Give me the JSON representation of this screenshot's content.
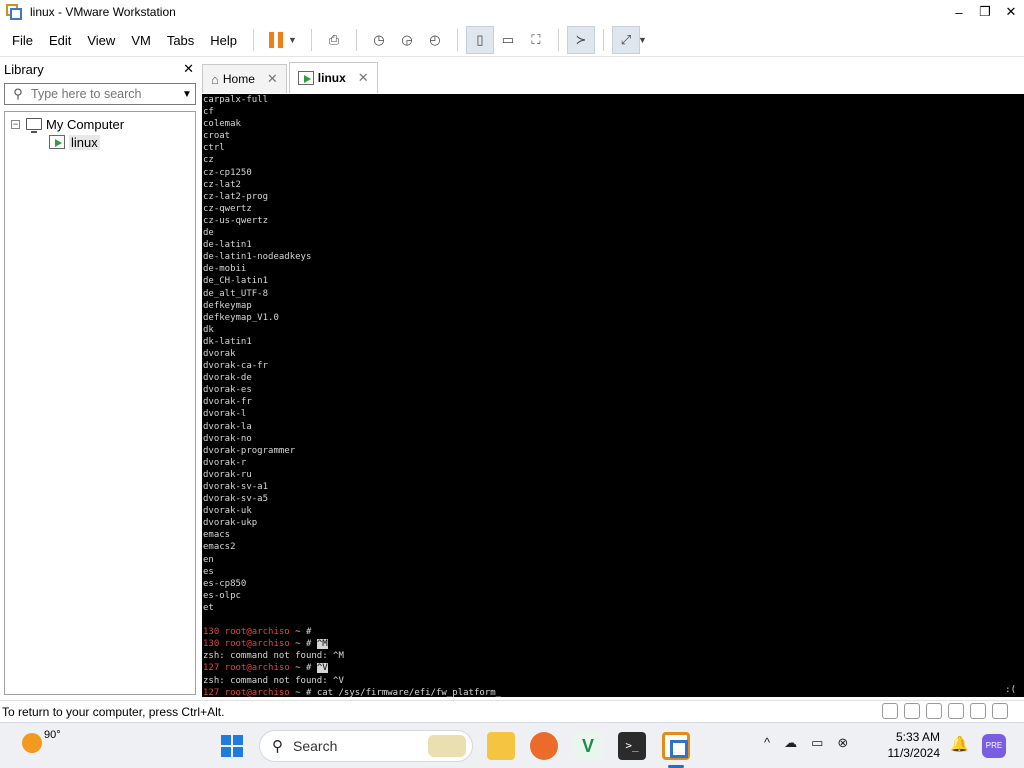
{
  "window": {
    "title": "linux - VMware Workstation",
    "controls": {
      "minimize": "–",
      "restore": "❐",
      "close": "✕"
    }
  },
  "menubar": {
    "items": [
      "File",
      "Edit",
      "View",
      "VM",
      "Tabs",
      "Help"
    ]
  },
  "toolbar": {
    "buttons": [
      {
        "name": "pause-icon"
      },
      {
        "name": "send-ctrl-alt-del-icon",
        "glyph": "⎙"
      },
      {
        "name": "snapshot-take-icon",
        "glyph": "◷"
      },
      {
        "name": "snapshot-revert-icon",
        "glyph": "◶"
      },
      {
        "name": "snapshot-manager-icon",
        "glyph": "◴"
      },
      {
        "name": "show-library-icon",
        "glyph": "▯"
      },
      {
        "name": "thumbnail-bar-icon",
        "glyph": "▭"
      },
      {
        "name": "full-screen-icon",
        "glyph": "⛶"
      },
      {
        "name": "console-view-icon",
        "glyph": "≻"
      },
      {
        "name": "stretch-guest-icon",
        "glyph": "⤢"
      }
    ]
  },
  "library": {
    "title": "Library",
    "close": "✕",
    "search_placeholder": "Type here to search",
    "tree": {
      "root": "My Computer",
      "expander": "−",
      "child": "linux"
    }
  },
  "tabs": [
    {
      "label": "Home",
      "close": "✕",
      "active": false
    },
    {
      "label": "linux",
      "close": "✕",
      "active": true
    }
  ],
  "console": {
    "lines": [
      "carpalx-full",
      "cf",
      "colemak",
      "croat",
      "ctrl",
      "cz",
      "cz-cp1250",
      "cz-lat2",
      "cz-lat2-prog",
      "cz-qwertz",
      "cz-us-qwertz",
      "de",
      "de-latin1",
      "de-latin1-nodeadkeys",
      "de-mobii",
      "de_CH-latin1",
      "de_alt_UTF-8",
      "defkeymap",
      "defkeymap_V1.0",
      "dk",
      "dk-latin1",
      "dvorak",
      "dvorak-ca-fr",
      "dvorak-de",
      "dvorak-es",
      "dvorak-fr",
      "dvorak-l",
      "dvorak-la",
      "dvorak-no",
      "dvorak-programmer",
      "dvorak-r",
      "dvorak-ru",
      "dvorak-sv-a1",
      "dvorak-sv-a5",
      "dvorak-uk",
      "dvorak-ukp",
      "emacs",
      "emacs2",
      "en",
      "es",
      "es-cp850",
      "es-olpc",
      "et"
    ],
    "prompt_lines": [
      {
        "code": "130",
        "user": "root@archiso",
        "rest": " ~ # ",
        "cmd": "",
        "cursor": ""
      },
      {
        "code": "130",
        "user": "root@archiso",
        "rest": " ~ # ",
        "cmd": "",
        "cursor": "^M"
      },
      {
        "plain": "zsh: command not found: ^M"
      },
      {
        "code": "127",
        "user": "root@archiso",
        "rest": " ~ # ",
        "cmd": "",
        "cursor": "^V"
      },
      {
        "plain": "zsh: command not found: ^V"
      },
      {
        "code": "127",
        "user": "root@archiso",
        "rest": " ~ # ",
        "cmd": "cat /sys/firmware/efi/fw_platform",
        "cursor": "_"
      }
    ],
    "indicator": ":("
  },
  "statusbar": {
    "text": "To return to your computer, press Ctrl+Alt."
  },
  "taskbar": {
    "temperature": "90°",
    "search_label": "Search",
    "terminal_glyph": ">_",
    "vs_glyph": "V",
    "time": "5:33 AM",
    "date": "11/3/2024",
    "tray": [
      "^",
      "☁",
      "▭",
      "⊗"
    ],
    "bell": "🔔",
    "copilot": "PRE"
  }
}
